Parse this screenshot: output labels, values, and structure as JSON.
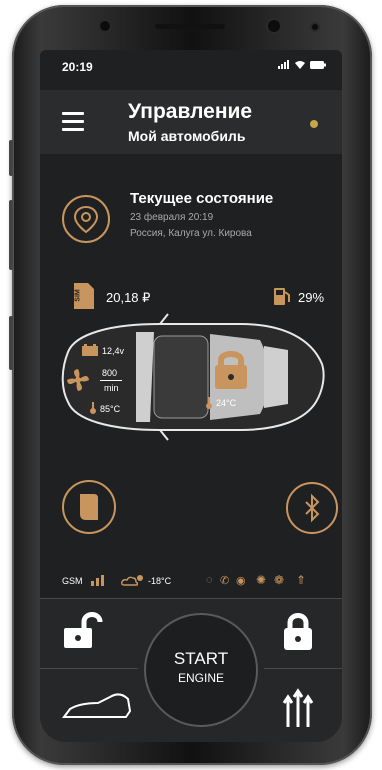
{
  "status": {
    "time": "20:19"
  },
  "header": {
    "title": "Управление",
    "subtitle": "Мой автомобиль"
  },
  "state": {
    "title": "Текущее состояние",
    "date": "23 февраля 20:19",
    "address": "Россия, Калуга ул. Кирова"
  },
  "sim": {
    "icon_text": "SIM",
    "balance": "20,18 ₽"
  },
  "fuel": {
    "level": "29%"
  },
  "car": {
    "battery": "12,4v",
    "rpm_value": "800",
    "rpm_unit": "min",
    "engine_temp": "85°C",
    "cabin_temp": "24°C"
  },
  "tray": {
    "gsm": "GSM",
    "weather_temp": "-18°C"
  },
  "controls": {
    "start_line1": "START",
    "start_line2": "ENGINE"
  },
  "colors": {
    "accent": "#c9955e",
    "background": "#1f2021",
    "online": "#c7a54c"
  }
}
